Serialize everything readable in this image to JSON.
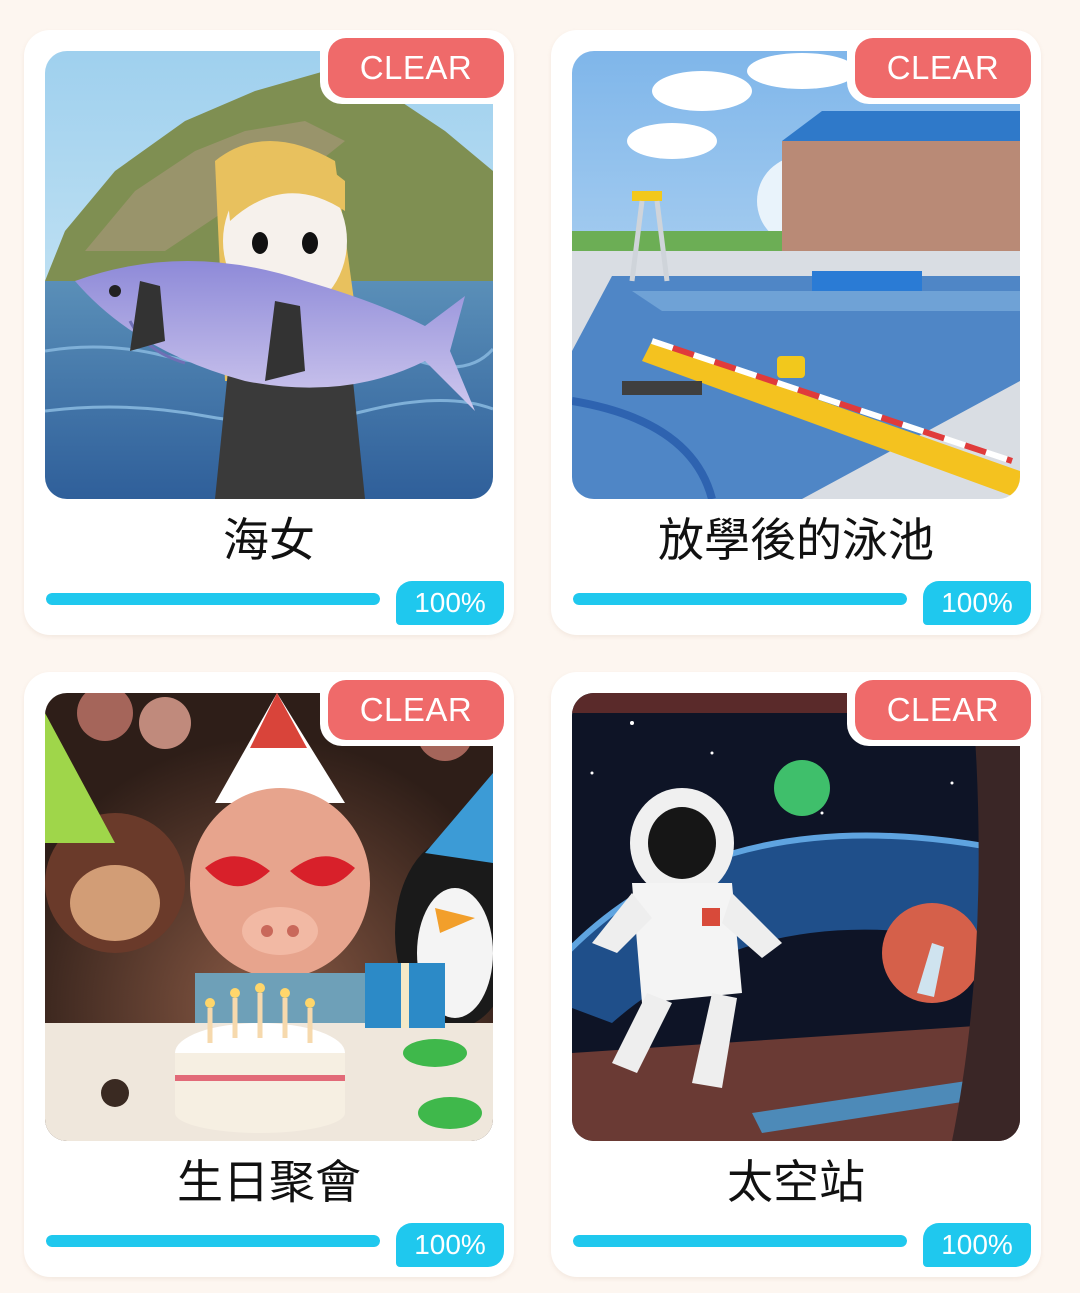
{
  "levels": [
    {
      "title": "海女",
      "badge": "CLEAR",
      "progress_label": "100%",
      "progress": 1.0,
      "image": "diver-with-tuna"
    },
    {
      "title": "放學後的泳池",
      "badge": "CLEAR",
      "progress_label": "100%",
      "progress": 1.0,
      "image": "school-swimming-pool"
    },
    {
      "title": "生日聚會",
      "badge": "CLEAR",
      "progress_label": "100%",
      "progress": 1.0,
      "image": "pig-birthday-party"
    },
    {
      "title": "太空站",
      "badge": "CLEAR",
      "progress_label": "100%",
      "progress": 1.0,
      "image": "astronaut-space-station"
    }
  ],
  "colors": {
    "background": "#fdf6f0",
    "badge": "#ef6a6a",
    "progress": "#1fc8ee"
  }
}
